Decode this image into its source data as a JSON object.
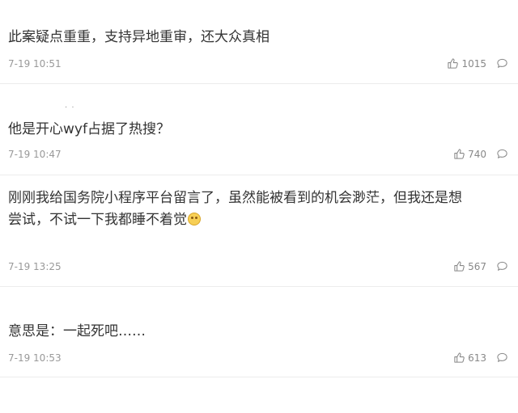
{
  "comments": [
    {
      "text": "此案疑点重重，支持异地重审，还大众真相",
      "time": "7-19 10:51",
      "likes": "1015"
    },
    {
      "dots": "· ·",
      "text": "他是开心wyf占据了热搜？",
      "time": "7-19 10:47",
      "likes": "740"
    },
    {
      "text_line1": "刚刚我给国务院小程序平台留言了，虽然能被看到的机会渺茫，但我还是想",
      "text_line2": "尝试，不试一下我都睡不着觉",
      "time": "7-19 13:25",
      "likes": "567"
    },
    {
      "text": "意思是：一起死吧……",
      "time": "7-19 10:53",
      "likes": "613"
    }
  ],
  "icons": {
    "like": "thumbs-up-icon",
    "reply": "comment-bubble-icon",
    "emoji": "crying-face-emoji"
  }
}
